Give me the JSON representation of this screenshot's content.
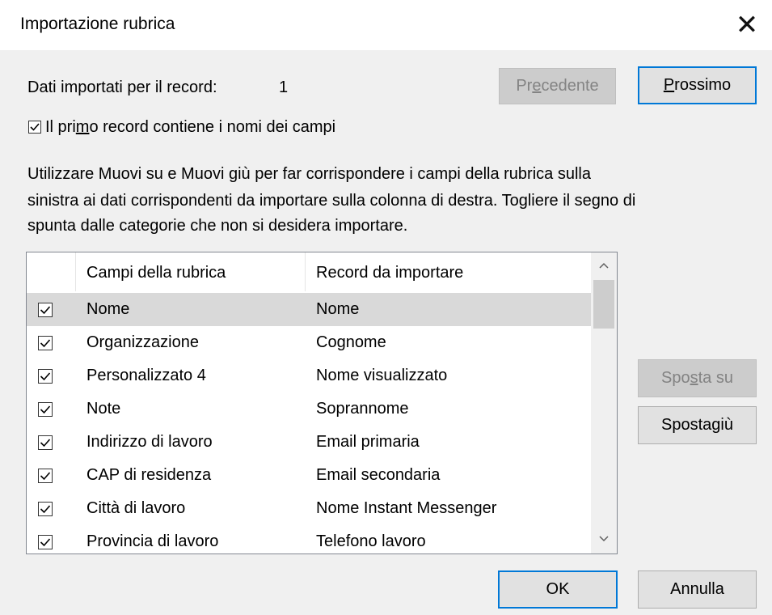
{
  "window": {
    "title": "Importazione rubrica"
  },
  "record_info": {
    "label": "Dati importati per il record:",
    "value": "1"
  },
  "nav": {
    "prev": {
      "pre": "Pr",
      "key": "e",
      "post": "cedente"
    },
    "next": {
      "pre": "",
      "key": "P",
      "post": "rossimo"
    }
  },
  "first_record": {
    "pre": "Il pri",
    "key": "m",
    "post": "o record contiene i nomi dei campi",
    "checked": true
  },
  "instructions": [
    "Utilizzare Muovi su e Muovi giù per far corrispondere i campi della rubrica sulla",
    "sinistra ai dati corrispondenti da importare sulla colonna di destra. Togliere il segno di",
    "spunta dalle categorie che non si desidera importare."
  ],
  "table": {
    "columns": [
      "Campi della rubrica",
      "Record da importare"
    ],
    "rows": [
      {
        "field": "Nome",
        "record": "Nome",
        "checked": true,
        "selected": true
      },
      {
        "field": "Organizzazione",
        "record": "Cognome",
        "checked": true
      },
      {
        "field": "Personalizzato 4",
        "record": "Nome visualizzato",
        "checked": true
      },
      {
        "field": "Note",
        "record": "Soprannome",
        "checked": true
      },
      {
        "field": "Indirizzo di lavoro",
        "record": "Email primaria",
        "checked": true
      },
      {
        "field": "CAP di residenza",
        "record": "Email secondaria",
        "checked": true
      },
      {
        "field": "Città di lavoro",
        "record": "Nome Instant Messenger",
        "checked": true
      },
      {
        "field": "Provincia di lavoro",
        "record": "Telefono lavoro",
        "checked": true
      }
    ]
  },
  "move": {
    "up": {
      "pre": "Spo",
      "key": "s",
      "post": "ta su"
    },
    "down": {
      "pre": "Sposta ",
      "key": "g",
      "post": "iù"
    }
  },
  "footer": {
    "ok": "OK",
    "cancel": "Annulla"
  },
  "icons": {
    "close": "close-icon",
    "scroll_up": "chevron-up-icon",
    "scroll_down": "chevron-down-icon",
    "check": "check-icon"
  },
  "colors": {
    "accent": "#0078d7",
    "selected_row": "#d9d9d9"
  }
}
